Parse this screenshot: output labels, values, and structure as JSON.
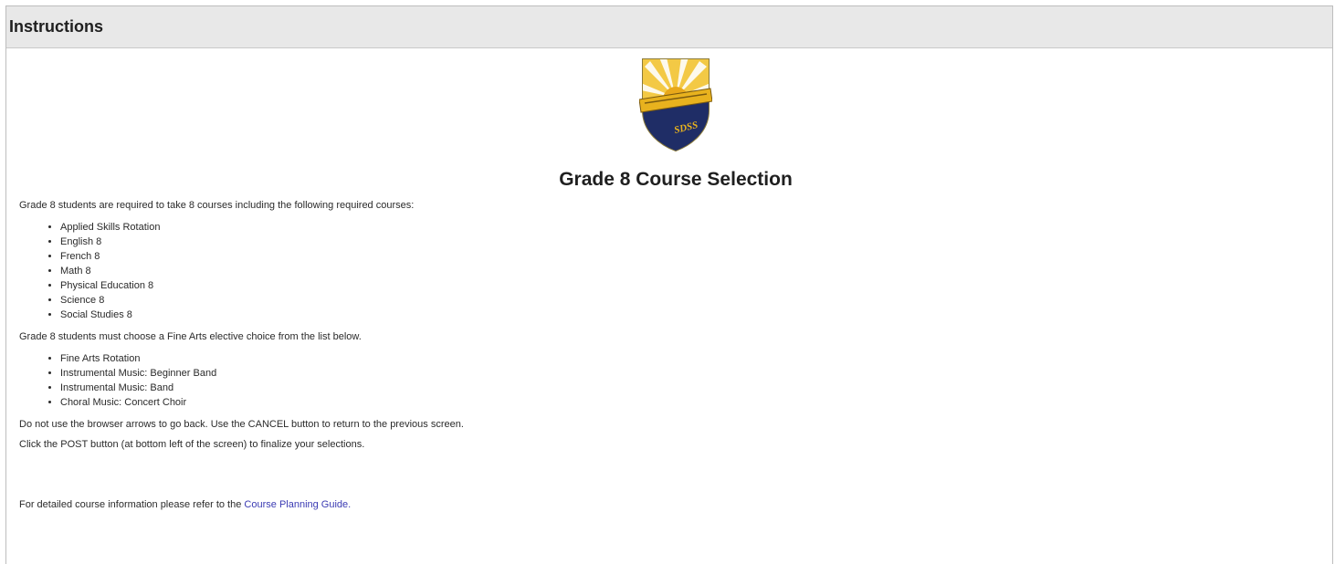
{
  "header": {
    "title": "Instructions"
  },
  "crest": {
    "text": "SDSS",
    "colors": {
      "gold": "#e8b21e",
      "navy": "#1f2d66"
    }
  },
  "page_title": "Grade 8 Course Selection",
  "required_intro": "Grade 8 students are required to take 8 courses including the following required courses:",
  "required_courses": [
    "Applied Skills Rotation",
    "English 8",
    "French 8",
    "Math 8",
    "Physical Education 8",
    "Science 8",
    "Social Studies 8"
  ],
  "elective_intro": "Grade 8 students must choose a Fine Arts elective choice from the list below.",
  "elective_courses": [
    "Fine Arts Rotation",
    "Instrumental Music: Beginner Band",
    "Instrumental Music: Band",
    "Choral Music: Concert Choir"
  ],
  "cancel_note": "Do not use the browser arrows to go back.  Use the CANCEL button to return to the previous screen.",
  "post_note": "Click the POST button (at bottom left of the screen) to finalize your selections.",
  "guide_prefix": "For detailed course information please refer to the ",
  "guide_link": "Course Planning Guide."
}
